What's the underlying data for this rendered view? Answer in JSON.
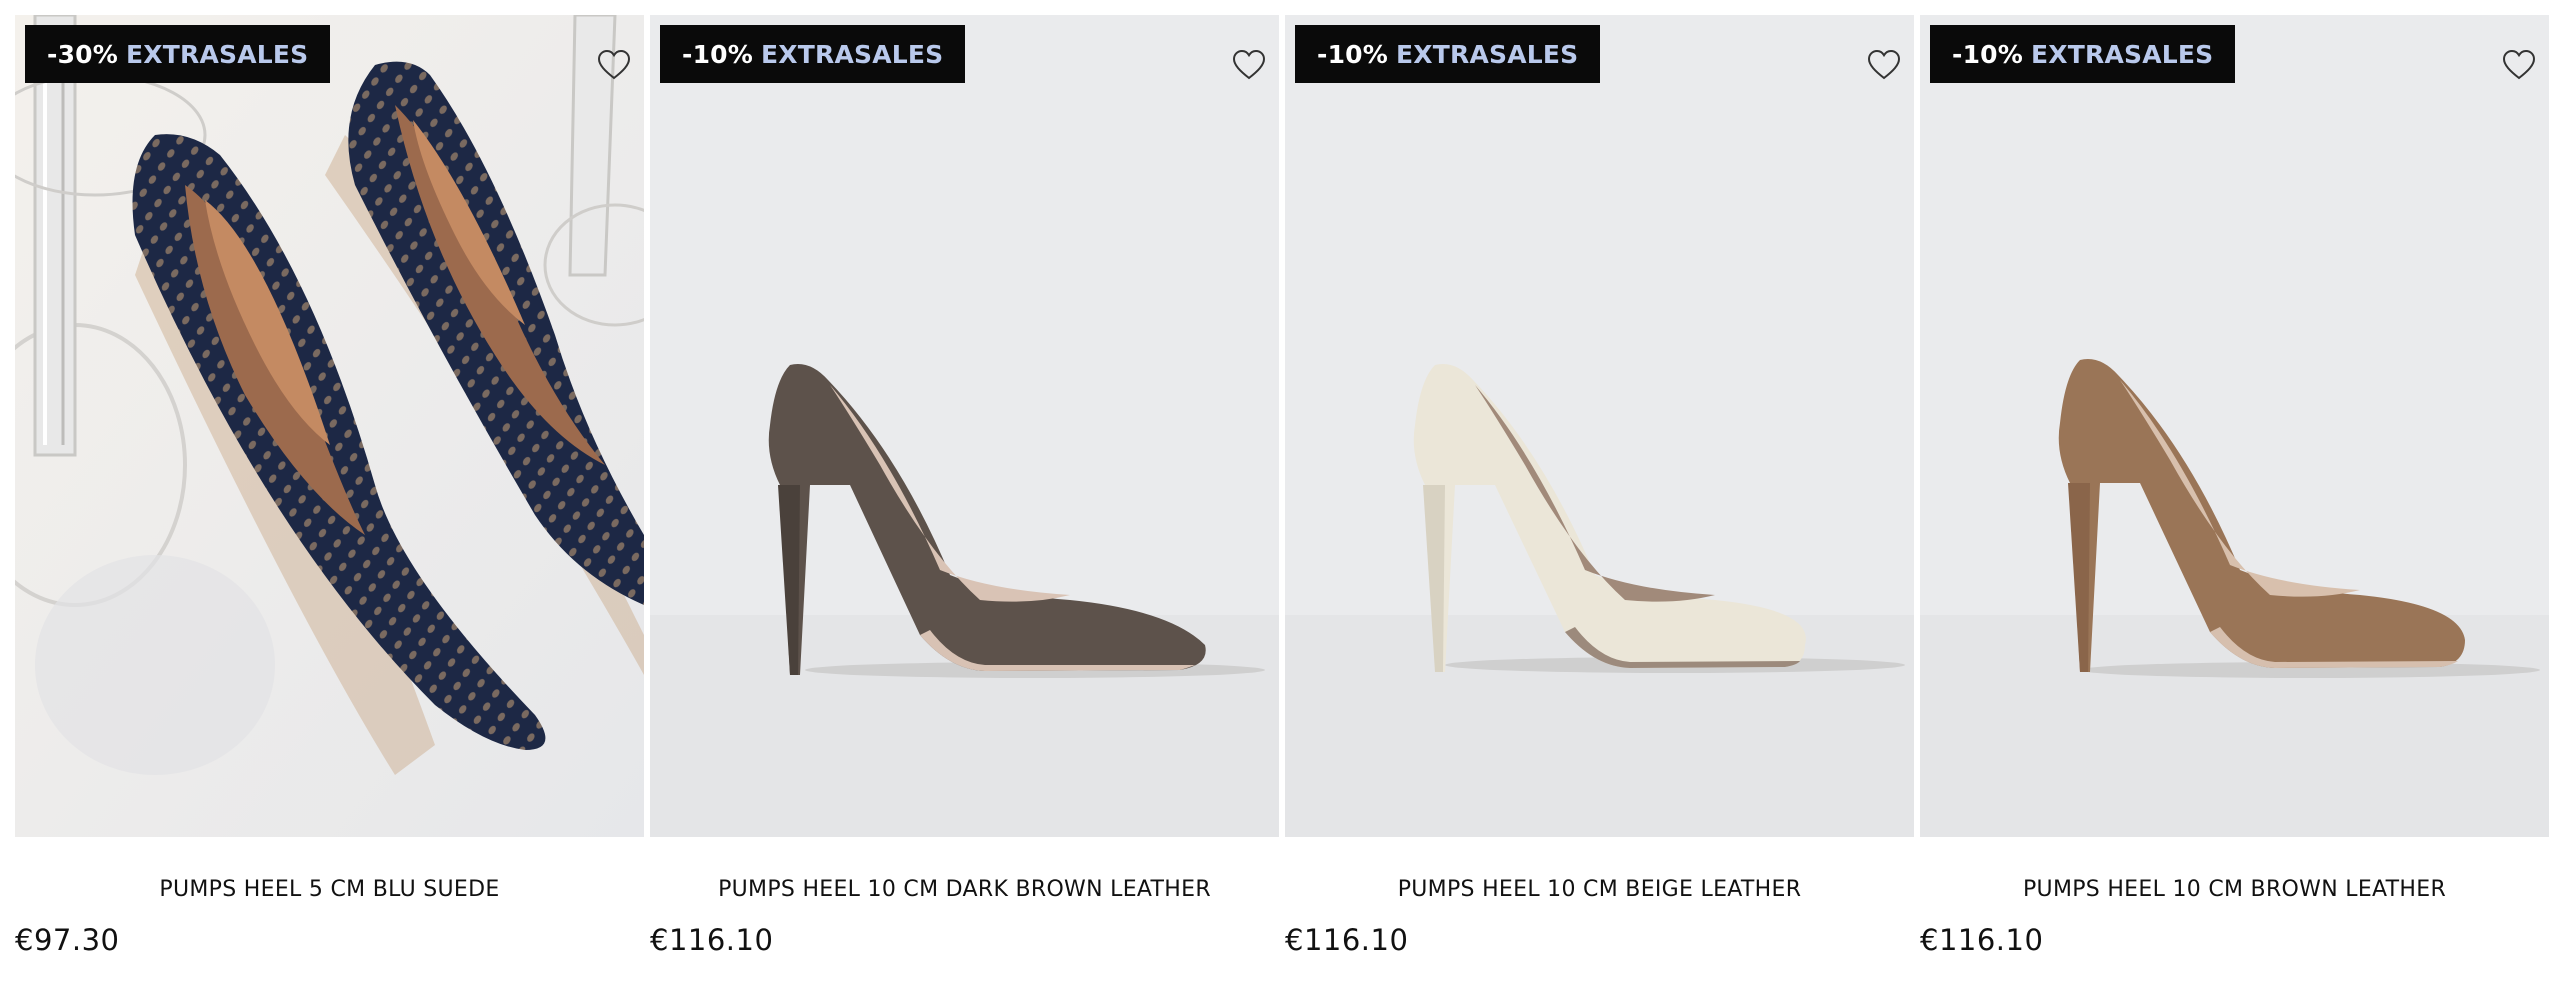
{
  "products": [
    {
      "badge_discount": "-30%",
      "badge_label": "EXTRASALES",
      "name": "PUMPS HEEL 5 CM BLU SUEDE",
      "price": "€97.30",
      "wishlist_icon": "heart-outline-icon"
    },
    {
      "badge_discount": "-10%",
      "badge_label": "EXTRASALES",
      "name": "PUMPS HEEL 10 CM DARK BROWN LEATHER",
      "price": "€116.10",
      "wishlist_icon": "heart-outline-icon",
      "shoe_color": "#5d524b"
    },
    {
      "badge_discount": "-10%",
      "badge_label": "EXTRASALES",
      "name": "PUMPS HEEL 10 CM BEIGE LEATHER",
      "price": "€116.10",
      "wishlist_icon": "heart-outline-icon",
      "shoe_color": "#ebe6d8"
    },
    {
      "badge_discount": "-10%",
      "badge_label": "EXTRASALES",
      "name": "PUMPS HEEL 10 CM BROWN LEATHER",
      "price": "€116.10",
      "wishlist_icon": "heart-outline-icon",
      "shoe_color": "#9a7557"
    }
  ],
  "colors": {
    "badge_background": "#0a0a0a",
    "badge_discount_text": "#ffffff",
    "badge_label_text": "#b9c9ec",
    "image_background": "#eaebed"
  }
}
